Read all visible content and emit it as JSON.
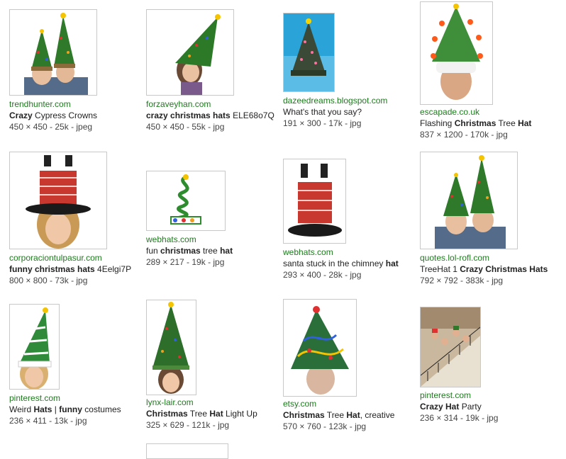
{
  "results": [
    {
      "source": "trendhunter.com",
      "title_parts": [
        {
          "text": "Crazy",
          "bold": true
        },
        {
          "text": " Cypress Crowns",
          "bold": false
        }
      ],
      "meta": "450 × 450 - 25k - jpeg",
      "image": "two-people-tree-hats"
    },
    {
      "source": "forzaveyhan.com",
      "title_parts": [
        {
          "text": "crazy christmas hats",
          "bold": true
        },
        {
          "text": " ELE68o7Q",
          "bold": false
        }
      ],
      "meta": "450 × 450 - 55k - jpg",
      "image": "woman-tree-hat"
    },
    {
      "source": "dazeedreams.blogspot.com",
      "title_parts": [
        {
          "text": "What's that you say?",
          "bold": false
        }
      ],
      "meta": "191 × 300 - 17k - jpg",
      "image": "lit-tree-hat-blue"
    },
    {
      "source": "escapade.co.uk",
      "title_parts": [
        {
          "text": "Flashing ",
          "bold": false
        },
        {
          "text": "Christmas",
          "bold": true
        },
        {
          "text": " Tree ",
          "bold": false
        },
        {
          "text": "Hat",
          "bold": true
        }
      ],
      "meta": "837 × 1200 - 170k - jpg",
      "image": "man-sequin-tree-hat"
    },
    {
      "source": "corporaciontulpasur.com",
      "title_parts": [
        {
          "text": "funny christmas hats",
          "bold": true
        },
        {
          "text": " 4Eelgi7P",
          "bold": false
        }
      ],
      "meta": "800 × 800 - 73k - jpg",
      "image": "woman-chimney-hat"
    },
    {
      "source": "webhats.com",
      "title_parts": [
        {
          "text": "fun ",
          "bold": false
        },
        {
          "text": "christmas",
          "bold": true
        },
        {
          "text": " tree ",
          "bold": false
        },
        {
          "text": "hat",
          "bold": true
        }
      ],
      "meta": "289 × 217 - 19k - jpg",
      "image": "spring-tree-hat"
    },
    {
      "source": "webhats.com",
      "title_parts": [
        {
          "text": "santa stuck in the chimney ",
          "bold": false
        },
        {
          "text": "hat",
          "bold": true
        }
      ],
      "meta": "293 × 400 - 28k - jpg",
      "image": "chimney-hat"
    },
    {
      "source": "quotes.lol-rofl.com",
      "title_parts": [
        {
          "text": "TreeHat 1 ",
          "bold": false
        },
        {
          "text": "Crazy Christmas Hats",
          "bold": true
        }
      ],
      "meta": "792 × 792 - 383k - jpg",
      "image": "two-people-tree-hats-2"
    },
    {
      "source": "pinterest.com",
      "title_parts": [
        {
          "text": "Weird ",
          "bold": false
        },
        {
          "text": "Hats",
          "bold": true
        },
        {
          "text": " | ",
          "bold": false
        },
        {
          "text": "funny",
          "bold": true
        },
        {
          "text": " costumes",
          "bold": false
        }
      ],
      "meta": "236 × 411 - 13k - jpg",
      "image": "woman-white-tree-hat"
    },
    {
      "source": "lynx-lair.com",
      "title_parts": [
        {
          "text": "Christmas",
          "bold": true
        },
        {
          "text": " Tree ",
          "bold": false
        },
        {
          "text": "Hat",
          "bold": true
        },
        {
          "text": " Light Up",
          "bold": false
        }
      ],
      "meta": "325 × 629 - 121k - jpg",
      "image": "woman-tall-tree-hat"
    },
    {
      "source": "etsy.com",
      "title_parts": [
        {
          "text": "Christmas",
          "bold": true
        },
        {
          "text": " Tree ",
          "bold": false
        },
        {
          "text": "Hat",
          "bold": true
        },
        {
          "text": ", creative",
          "bold": false
        }
      ],
      "meta": "570 × 760 - 123k - jpg",
      "image": "knit-tree-hat"
    },
    {
      "source": "pinterest.com",
      "title_parts": [
        {
          "text": "Crazy Hat",
          "bold": true
        },
        {
          "text": " Party",
          "bold": false
        }
      ],
      "meta": "236 × 314 - 19k - jpg",
      "image": "party-group-stairs"
    }
  ]
}
